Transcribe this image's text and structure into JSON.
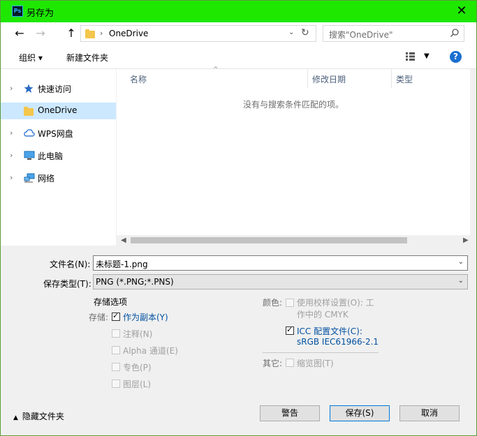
{
  "window": {
    "title": "另存为",
    "app_icon": "Ps"
  },
  "nav": {
    "back": "←",
    "forward": "→",
    "up": "↑",
    "path": "OneDrive",
    "search_placeholder": "搜索\"OneDrive\""
  },
  "toolbar": {
    "organize": "组织 ▾",
    "new_folder": "新建文件夹",
    "help": "?"
  },
  "sidebar": {
    "items": [
      {
        "label": "快速访问",
        "icon": "star-icon"
      },
      {
        "label": "OneDrive",
        "icon": "folder-icon",
        "selected": true
      },
      {
        "label": "WPS网盘",
        "icon": "cloud-icon"
      },
      {
        "label": "此电脑",
        "icon": "computer-icon"
      },
      {
        "label": "网络",
        "icon": "network-icon"
      }
    ]
  },
  "file_list": {
    "columns": [
      "名称",
      "修改日期",
      "类型"
    ],
    "empty_message": "没有与搜索条件匹配的项。"
  },
  "form": {
    "filename_label": "文件名(N):",
    "filename_value": "未标题-1.png",
    "filetype_label": "保存类型(T):",
    "filetype_value": "PNG (*.PNG;*.PNS)"
  },
  "options": {
    "section_title": "存储选项",
    "storage_label": "存储:",
    "as_copy": "作为副本(Y)",
    "notes": "注释(N)",
    "alpha": "Alpha 通道(E)",
    "spot": "专色(P)",
    "layers": "图层(L)",
    "color_label": "颜色:",
    "proof_line1": "使用校样设置(O): 工",
    "proof_line2": "作中的 CMYK",
    "icc_line1": "ICC 配置文件(C):",
    "icc_line2": "sRGB IEC61966-2.1",
    "other_label": "其它:",
    "thumbnail": "缩览图(T)"
  },
  "footer": {
    "hide_folders": "隐藏文件夹",
    "warning": "警告",
    "save": "保存(S)",
    "cancel": "取消"
  },
  "colors": {
    "titlebar": "#1ee800",
    "accent": "#0078d7"
  }
}
